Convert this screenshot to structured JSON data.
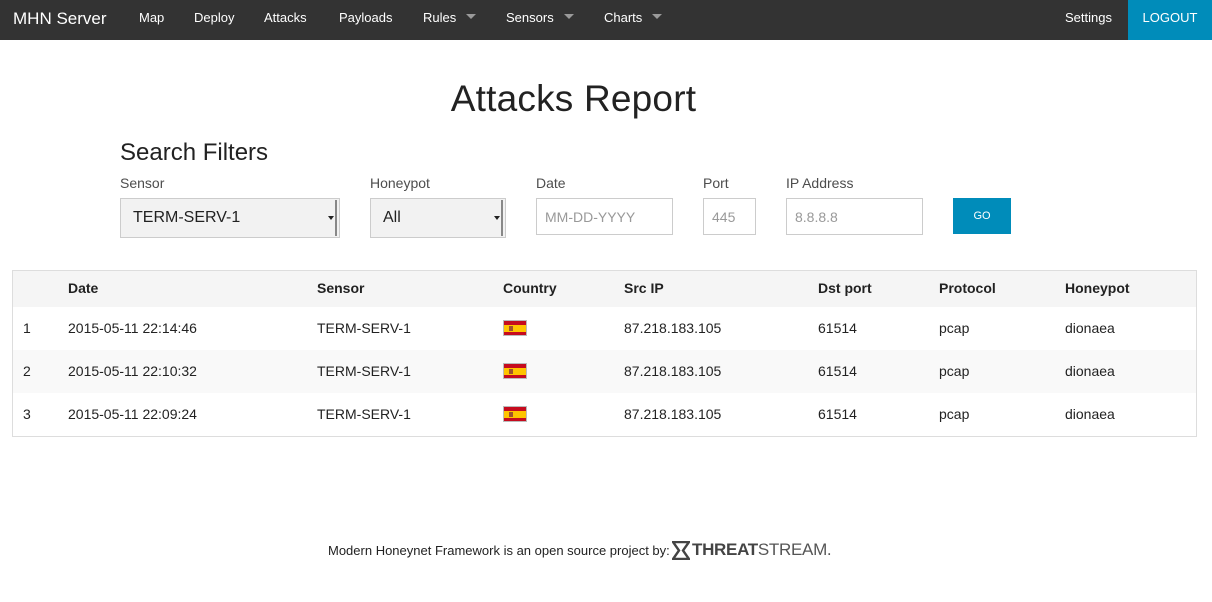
{
  "nav": {
    "brand": "MHN Server",
    "items": [
      {
        "label": "Map"
      },
      {
        "label": "Deploy"
      },
      {
        "label": "Attacks"
      },
      {
        "label": "Payloads"
      },
      {
        "label": "Rules",
        "dropdown": true
      },
      {
        "label": "Sensors",
        "dropdown": true
      },
      {
        "label": "Charts",
        "dropdown": true
      }
    ],
    "settings": "Settings",
    "logout": "LOGOUT"
  },
  "page": {
    "title": "Attacks Report"
  },
  "filters": {
    "title": "Search Filters",
    "sensor_label": "Sensor",
    "sensor_value": "TERM-SERV-1",
    "honeypot_label": "Honeypot",
    "honeypot_value": "All",
    "date_label": "Date",
    "date_placeholder": "MM-DD-YYYY",
    "port_label": "Port",
    "port_placeholder": "445",
    "ip_label": "IP Address",
    "ip_placeholder": "8.8.8.8",
    "go_label": "GO"
  },
  "table": {
    "headers": [
      "",
      "Date",
      "Sensor",
      "Country",
      "Src IP",
      "Dst port",
      "Protocol",
      "Honeypot"
    ],
    "rows": [
      {
        "num": "1",
        "date": "2015-05-11 22:14:46",
        "sensor": "TERM-SERV-1",
        "country": "spain-flag-icon",
        "src_ip": "87.218.183.105",
        "dst_port": "61514",
        "protocol": "pcap",
        "honeypot": "dionaea"
      },
      {
        "num": "2",
        "date": "2015-05-11 22:10:32",
        "sensor": "TERM-SERV-1",
        "country": "spain-flag-icon",
        "src_ip": "87.218.183.105",
        "dst_port": "61514",
        "protocol": "pcap",
        "honeypot": "dionaea"
      },
      {
        "num": "3",
        "date": "2015-05-11 22:09:24",
        "sensor": "TERM-SERV-1",
        "country": "spain-flag-icon",
        "src_ip": "87.218.183.105",
        "dst_port": "61514",
        "protocol": "pcap",
        "honeypot": "dionaea"
      }
    ]
  },
  "footer": {
    "text": "Modern Honeynet Framework is an open source project by:",
    "logo_part1": "THREAT",
    "logo_part2": "STREAM."
  },
  "colors": {
    "nav_bg": "#333333",
    "accent": "#008cba",
    "flag_red": "#c60b1e",
    "flag_yellow": "#ffc400"
  }
}
